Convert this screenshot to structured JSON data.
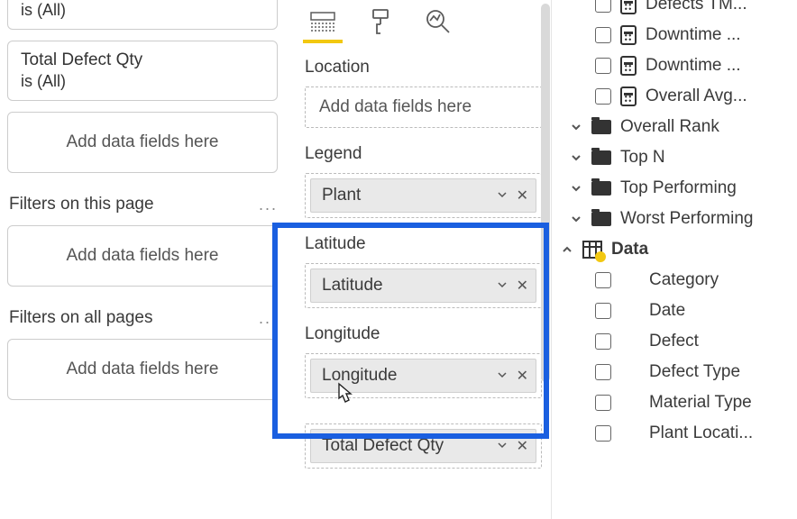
{
  "filters": {
    "card1_sub": "is (All)",
    "card2_title": "Total Defect Qty",
    "card2_sub": "is (All)",
    "dropzone": "Add data fields here",
    "page_header": "Filters on this page",
    "allpages_header": "Filters on all pages",
    "dots": "..."
  },
  "viz": {
    "location_label": "Location",
    "location_placeholder": "Add data fields here",
    "legend_label": "Legend",
    "legend_chip": "Plant",
    "latitude_label": "Latitude",
    "latitude_chip": "Latitude",
    "longitude_label": "Longitude",
    "longitude_chip": "Longitude",
    "size_chip": "Total Defect Qty"
  },
  "fields": {
    "calc": [
      "Defects TM...",
      "Downtime ...",
      "Downtime ...",
      "Overall Avg..."
    ],
    "groups": [
      "Overall Rank",
      "Top N",
      "Top Performing",
      "Worst Performing"
    ],
    "data_table": "Data",
    "columns": [
      "Category",
      "Date",
      "Defect",
      "Defect Type",
      "Material Type",
      "Plant Locati..."
    ]
  }
}
